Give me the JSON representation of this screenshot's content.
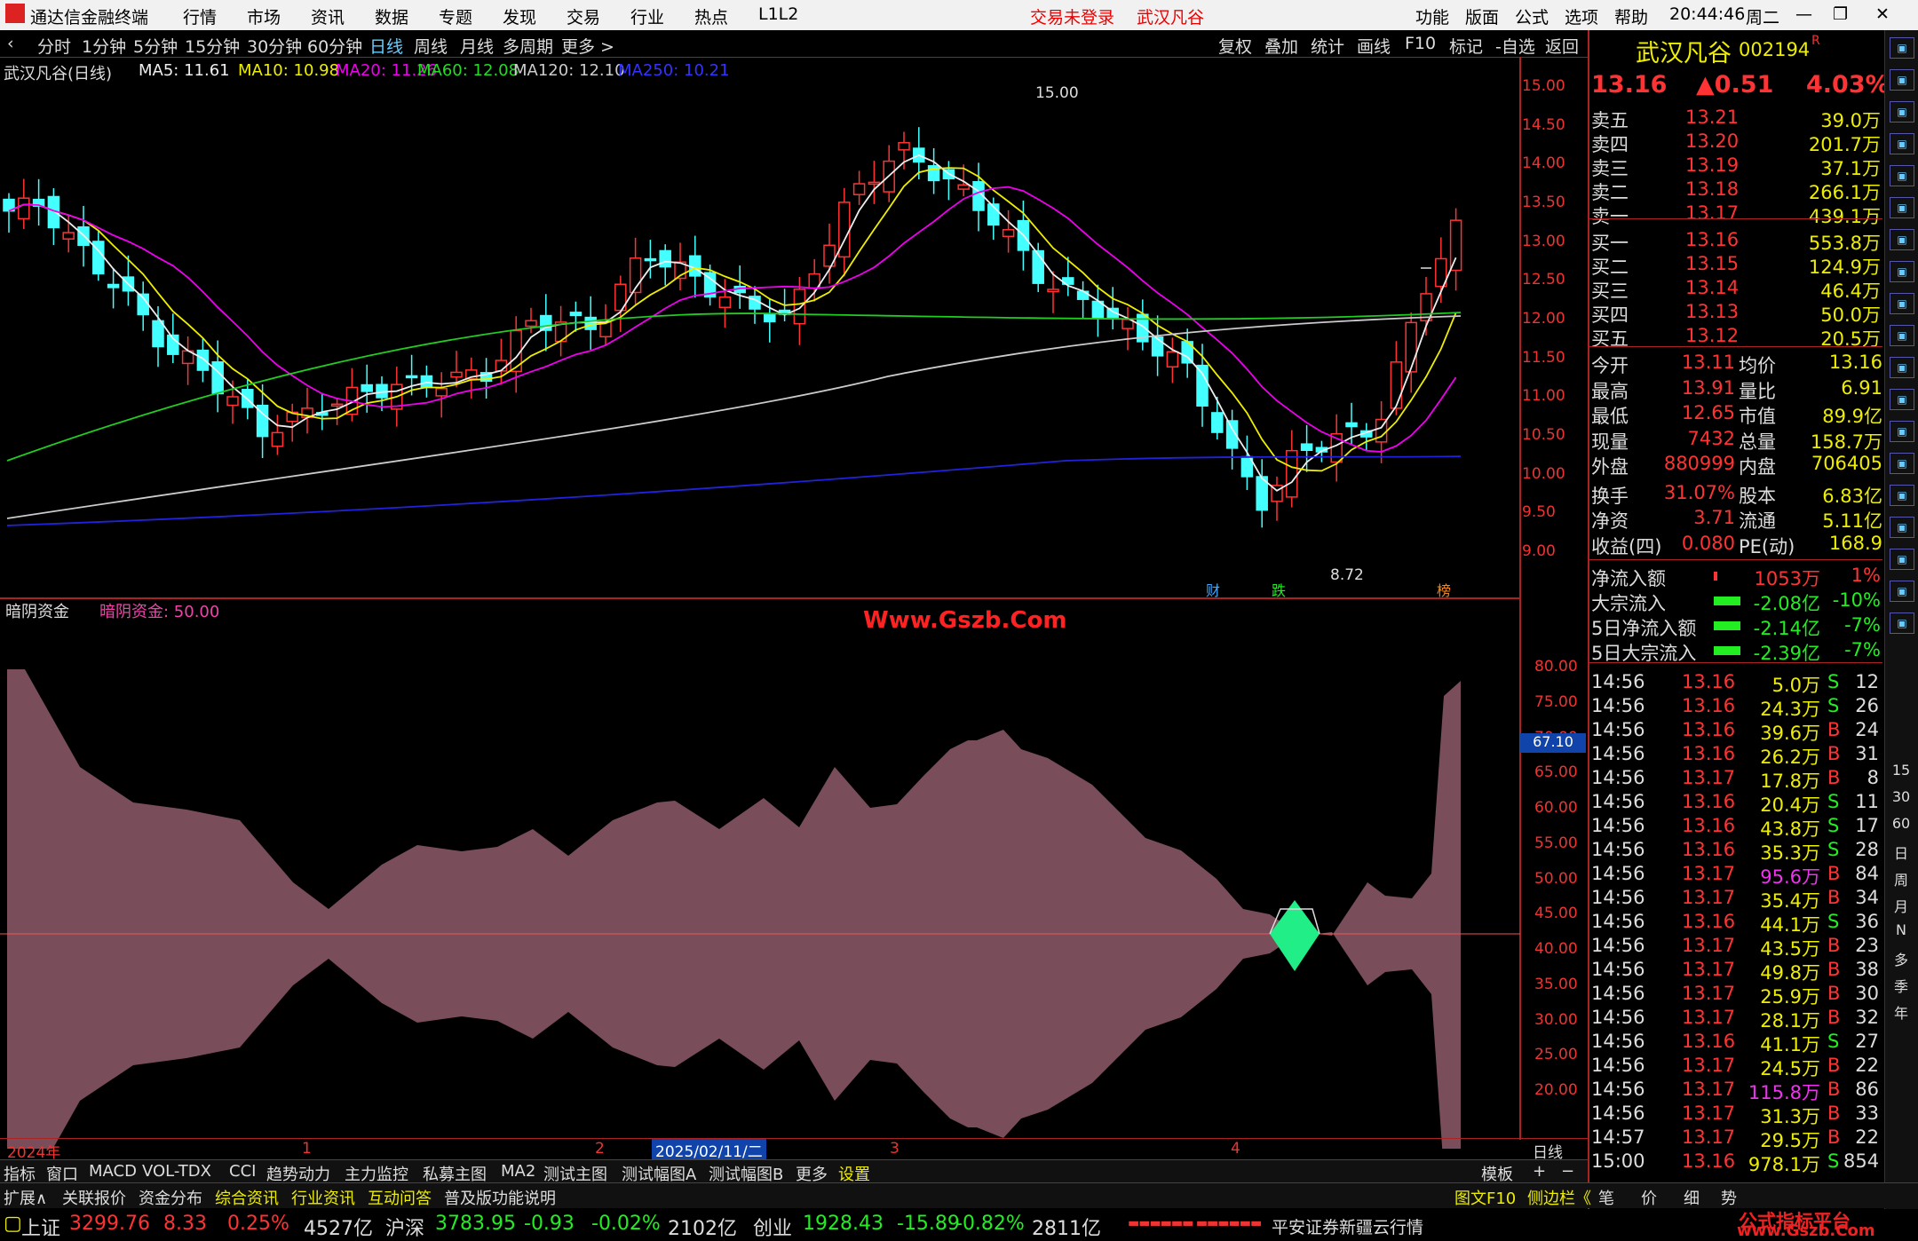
{
  "app": {
    "title": "通达信金融终端",
    "menus": [
      "行情",
      "市场",
      "资讯",
      "数据",
      "专题",
      "发现",
      "交易",
      "行业",
      "热点",
      "L1L2"
    ],
    "login_status": "交易未登录",
    "stock_name": "武汉凡谷",
    "right_menus": [
      "功能",
      "版面",
      "公式",
      "选项",
      "帮助"
    ],
    "time": "20:44:46",
    "weekday": "周二"
  },
  "periods": [
    "分时",
    "1分钟",
    "5分钟",
    "15分钟",
    "30分钟",
    "60分钟",
    "日线",
    "周线",
    "月线",
    "多周期",
    "更多 >"
  ],
  "toolbar": [
    "复权",
    "叠加",
    "统计",
    "画线",
    "F10",
    "标记",
    "-自选",
    "返回"
  ],
  "ma": {
    "label": "武汉凡谷(日线)",
    "ma5": "MA5: 11.61",
    "ma10": "MA10: 10.98",
    "ma20": "MA20: 11.26",
    "ma60": "MA60: 12.08",
    "ma120": "MA120: 12.10",
    "ma250": "MA250: 10.21"
  },
  "price_axis": [
    "15.00",
    "14.50",
    "14.00",
    "13.50",
    "13.00",
    "12.50",
    "12.00",
    "11.50",
    "11.00",
    "10.50",
    "10.00",
    "9.50",
    "9.00"
  ],
  "annot": {
    "high": "15.00",
    "low": "8.72",
    "t1": "财",
    "t2": "跌",
    "t3": "榜"
  },
  "indicator": {
    "name": "暗阴资金",
    "label": "暗阴资金: 50.00",
    "axis": [
      "80.00",
      "75.00",
      "70.00",
      "65.00",
      "60.00",
      "55.00",
      "50.00",
      "45.00",
      "40.00",
      "35.00",
      "30.00",
      "25.00",
      "20.00"
    ],
    "current": "67.10"
  },
  "watermark": "Www.Gszb.Com",
  "xaxis": {
    "year": "2024年",
    "m1": "1",
    "m2": "2",
    "date": "2025/02/11/二",
    "m4": "3",
    "m5": "4",
    "period": "日线"
  },
  "quote": {
    "name": "武汉凡谷",
    "code": "002194",
    "flag": "R",
    "price": "13.16",
    "change": "▲0.51",
    "pct": "4.03%"
  },
  "asks": [
    {
      "l": "卖五",
      "p": "13.21",
      "v": "39.0万"
    },
    {
      "l": "卖四",
      "p": "13.20",
      "v": "201.7万"
    },
    {
      "l": "卖三",
      "p": "13.19",
      "v": "37.1万"
    },
    {
      "l": "卖二",
      "p": "13.18",
      "v": "266.1万"
    },
    {
      "l": "卖一",
      "p": "13.17",
      "v": "439.1万"
    }
  ],
  "bids": [
    {
      "l": "买一",
      "p": "13.16",
      "v": "553.8万"
    },
    {
      "l": "买二",
      "p": "13.15",
      "v": "124.9万"
    },
    {
      "l": "买三",
      "p": "13.14",
      "v": "46.4万"
    },
    {
      "l": "买四",
      "p": "13.13",
      "v": "50.0万"
    },
    {
      "l": "买五",
      "p": "13.12",
      "v": "20.5万"
    }
  ],
  "stats": [
    [
      "今开",
      "13.11",
      "均价",
      "13.16"
    ],
    [
      "最高",
      "13.91",
      "量比",
      "6.91"
    ],
    [
      "最低",
      "12.65",
      "市值",
      "89.9亿"
    ],
    [
      "现量",
      "7432",
      "总量",
      "158.7万"
    ],
    [
      "外盘",
      "880999",
      "内盘",
      "706405"
    ],
    [
      "换手",
      "31.07%",
      "股本",
      "6.83亿"
    ],
    [
      "净资",
      "3.71",
      "流通",
      "5.11亿"
    ],
    [
      "收益(四)",
      "0.080",
      "PE(动)",
      "168.9"
    ]
  ],
  "flows": [
    [
      "净流入额",
      "1053万",
      "1%"
    ],
    [
      "大宗流入",
      "-2.08亿",
      "-10%"
    ],
    [
      "5日净流入额",
      "-2.14亿",
      "-7%"
    ],
    [
      "5日大宗流入",
      "-2.39亿",
      "-7%"
    ]
  ],
  "ticks": [
    [
      "14:56",
      "13.16",
      "5.0万",
      "S",
      "12"
    ],
    [
      "14:56",
      "13.16",
      "24.3万",
      "S",
      "26"
    ],
    [
      "14:56",
      "13.16",
      "39.6万",
      "B",
      "24"
    ],
    [
      "14:56",
      "13.16",
      "26.2万",
      "B",
      "31"
    ],
    [
      "14:56",
      "13.17",
      "17.8万",
      "B",
      "8"
    ],
    [
      "14:56",
      "13.16",
      "20.4万",
      "S",
      "11"
    ],
    [
      "14:56",
      "13.16",
      "43.8万",
      "S",
      "17"
    ],
    [
      "14:56",
      "13.16",
      "35.3万",
      "S",
      "28"
    ],
    [
      "14:56",
      "13.17",
      "95.6万",
      "B",
      "84"
    ],
    [
      "14:56",
      "13.17",
      "35.4万",
      "B",
      "34"
    ],
    [
      "14:56",
      "13.16",
      "44.1万",
      "S",
      "36"
    ],
    [
      "14:56",
      "13.17",
      "43.5万",
      "B",
      "23"
    ],
    [
      "14:56",
      "13.17",
      "49.8万",
      "B",
      "38"
    ],
    [
      "14:56",
      "13.17",
      "25.9万",
      "B",
      "30"
    ],
    [
      "14:56",
      "13.17",
      "28.1万",
      "B",
      "32"
    ],
    [
      "14:56",
      "13.16",
      "41.1万",
      "S",
      "27"
    ],
    [
      "14:56",
      "13.17",
      "24.5万",
      "B",
      "22"
    ],
    [
      "14:56",
      "13.17",
      "115.8万",
      "B",
      "86"
    ],
    [
      "14:56",
      "13.17",
      "31.3万",
      "B",
      "33"
    ],
    [
      "14:57",
      "13.17",
      "29.5万",
      "B",
      "22"
    ],
    [
      "15:00",
      "13.16",
      "978.1万",
      "S",
      "854"
    ]
  ],
  "side_icons": [
    "15",
    "30",
    "60",
    "日",
    "周",
    "月",
    "N",
    "多",
    "季",
    "年"
  ],
  "tabs1": [
    "指标",
    "窗口",
    "MACD",
    "VOL-TDX",
    "CCI",
    "趋势动力",
    "主力监控",
    "私募主图",
    "MA2",
    "测试主图",
    "测试幅图A",
    "测试幅图B",
    "更多",
    "设置"
  ],
  "tabs1_right": [
    "模板",
    "+",
    "−"
  ],
  "tabs2": [
    "扩展∧",
    "关联报价",
    "资金分布",
    "综合资讯",
    "行业资讯",
    "互动问答",
    "普及版功能说明"
  ],
  "tabs2_right": [
    "图文F10",
    "侧边栏《",
    "笔",
    "价",
    "细",
    "势"
  ],
  "status": {
    "sh": "上证",
    "sh_v": "3299.76",
    "sh_c": "8.33",
    "sh_p": "0.25%",
    "sh_a": "4527亿",
    "hs": "沪深",
    "hs_v": "3783.95",
    "hs_c": "-0.93",
    "hs_p": "-0.02%",
    "hs_a": "2102亿",
    "cy": "创业",
    "cy_v": "1928.43",
    "cy_c": "-15.89",
    "cy_p": "-0.82%",
    "cy_a": "2811亿",
    "broker": "平安证券新疆云行情",
    "brand1": "公式指标平台",
    "brand2": "www.Gszb.Com"
  }
}
